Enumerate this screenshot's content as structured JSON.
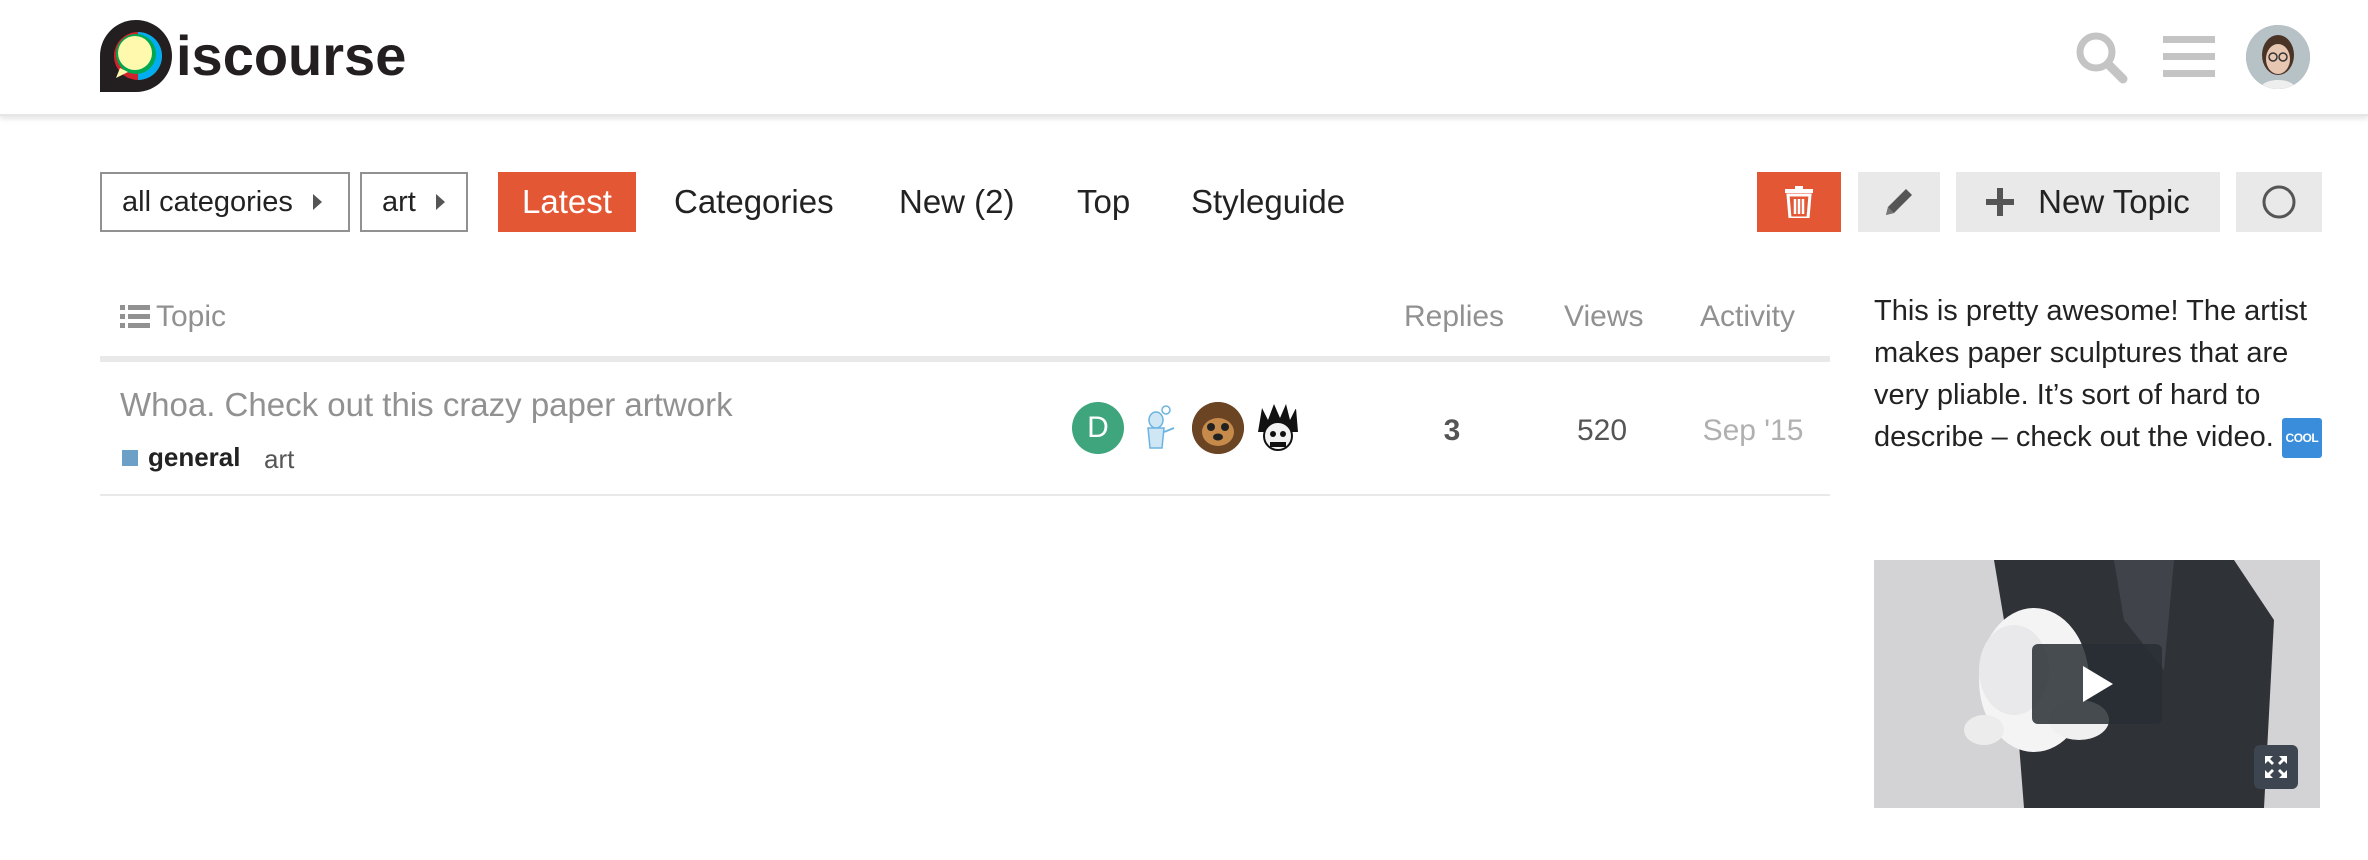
{
  "header": {
    "logo_text": "iscourse",
    "icons": [
      "search-icon",
      "hamburger-menu-icon",
      "user-avatar"
    ]
  },
  "nav": {
    "category_dropdown": "all categories",
    "subcategory_dropdown": "art",
    "links": [
      {
        "label": "Latest",
        "active": true
      },
      {
        "label": "Categories",
        "active": false
      },
      {
        "label": "New (2)",
        "active": false
      },
      {
        "label": "Top",
        "active": false
      },
      {
        "label": "Styleguide",
        "active": false
      }
    ],
    "new_topic_label": "New Topic"
  },
  "table": {
    "headers": {
      "topic": "Topic",
      "replies": "Replies",
      "views": "Views",
      "activity": "Activity"
    },
    "rows": [
      {
        "title": "Whoa. Check out this crazy paper artwork",
        "category": "general",
        "tag": "art",
        "poster_initial": "D",
        "replies": "3",
        "views": "520",
        "activity": "Sep '15"
      }
    ]
  },
  "sidebar": {
    "excerpt": "This is pretty awesome! The artist makes paper sculptures that are very pliable. It’s sort of hard to describe – check out the video.",
    "emoji_label": "COOL"
  },
  "colors": {
    "accent": "#e45735",
    "category_general": "#6ca0c7",
    "poster_d": "#3ea57d"
  }
}
